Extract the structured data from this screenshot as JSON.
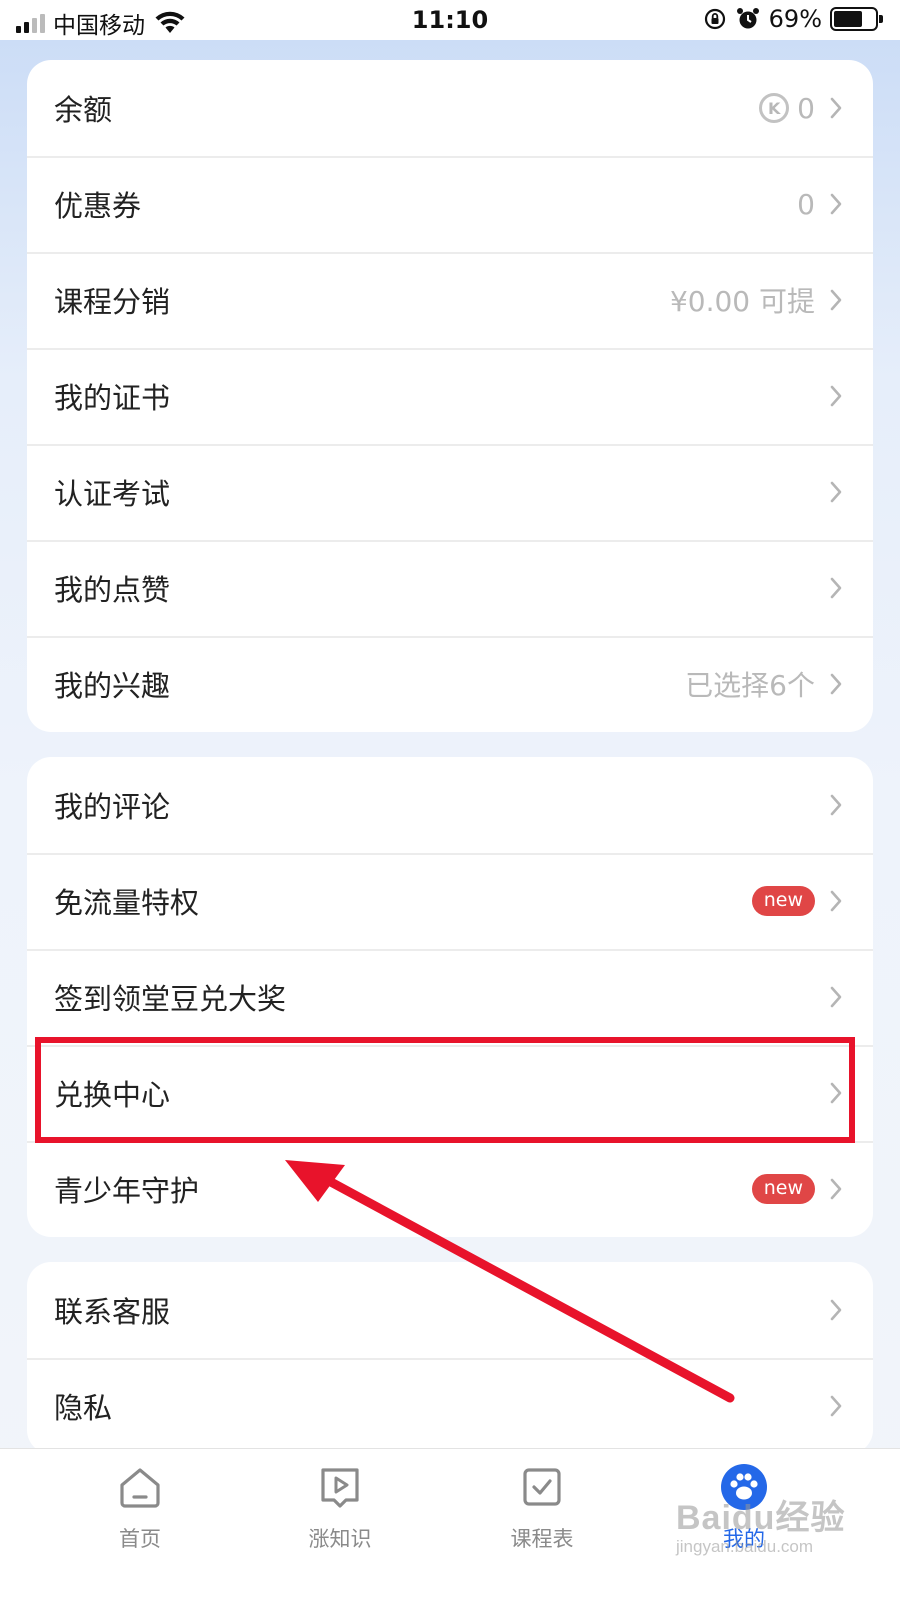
{
  "status_bar": {
    "carrier": "中国移动",
    "time": "11:10",
    "battery": "69%",
    "battery_level": 0.69
  },
  "cards": [
    {
      "rows": [
        {
          "label": "余额",
          "value": "0",
          "icon": "coin-icon",
          "coin_glyph": "K"
        },
        {
          "label": "优惠券",
          "value": "0"
        },
        {
          "label": "课程分销",
          "value": "¥0.00 可提"
        },
        {
          "label": "我的证书"
        },
        {
          "label": "认证考试"
        },
        {
          "label": "我的点赞"
        },
        {
          "label": "我的兴趣",
          "value": "已选择6个"
        }
      ]
    },
    {
      "rows": [
        {
          "label": "我的评论"
        },
        {
          "label": "免流量特权",
          "badge": "new"
        },
        {
          "label": "签到领堂豆兑大奖"
        },
        {
          "label": "兑换中心",
          "highlighted": true
        },
        {
          "label": "青少年守护",
          "badge": "new"
        }
      ]
    },
    {
      "rows": [
        {
          "label": "联系客服"
        },
        {
          "label": "隐私"
        }
      ]
    }
  ],
  "tab_bar": {
    "tabs": [
      {
        "label": "首页",
        "icon": "home-icon"
      },
      {
        "label": "涨知识",
        "icon": "play-icon"
      },
      {
        "label": "课程表",
        "icon": "schedule-icon"
      },
      {
        "label": "我的",
        "icon": "paw-icon",
        "active": true
      }
    ]
  },
  "watermark": {
    "main": "Baidu经验",
    "sub": "jingyan.baidu.com"
  },
  "colors": {
    "accent": "#2468e8",
    "badge": "#e04646",
    "annotation": "#e8132b",
    "muted": "#b9b9b9"
  }
}
